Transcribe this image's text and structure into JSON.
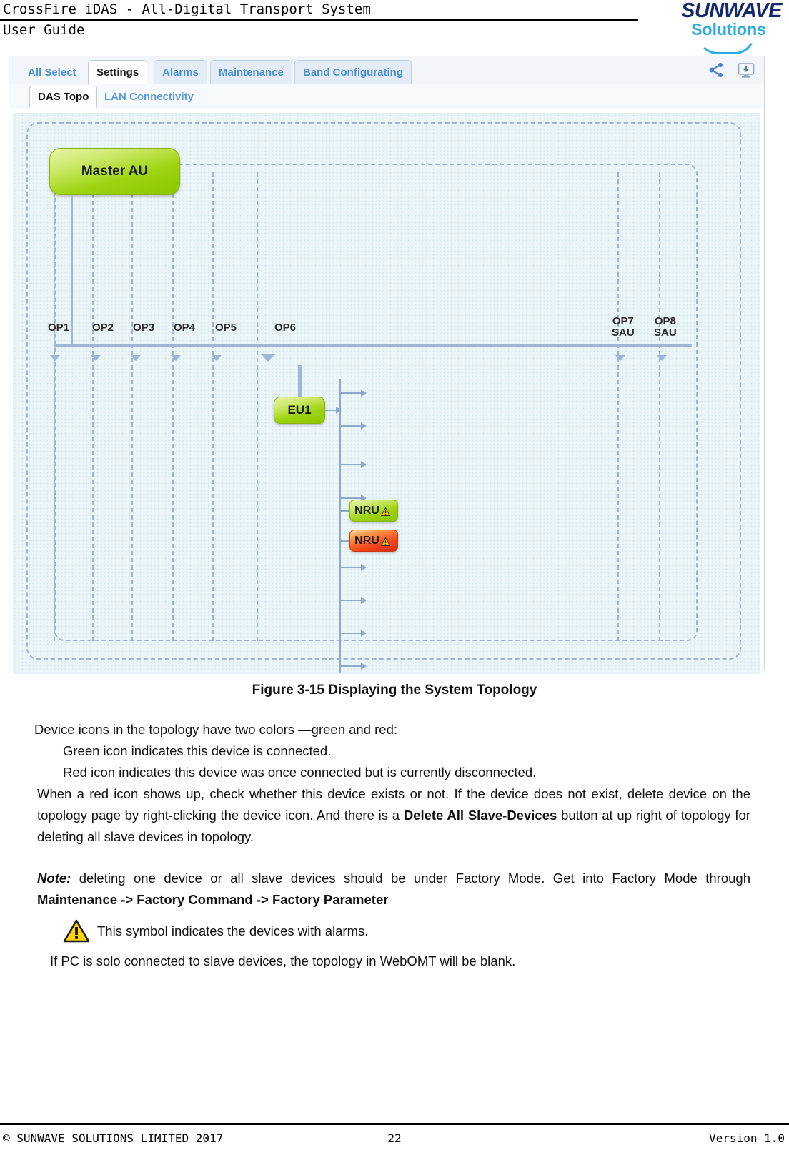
{
  "header": {
    "doc_title": "CrossFire iDAS - All-Digital Transport System",
    "doc_subtitle": "User Guide",
    "logo_primary": "SUNWAVE",
    "logo_secondary": "Solutions"
  },
  "app": {
    "tabs": [
      {
        "label": "All Select",
        "state": "plain"
      },
      {
        "label": "Settings",
        "state": "active"
      },
      {
        "label": "Alarms",
        "state": "idle"
      },
      {
        "label": "Maintenance",
        "state": "idle"
      },
      {
        "label": "Band Configurating",
        "state": "idle"
      }
    ],
    "toolbar_icons": [
      {
        "name": "share-icon"
      },
      {
        "name": "download-screen-icon"
      }
    ],
    "subtabs": [
      {
        "label": "DAS Topo",
        "state": "active"
      },
      {
        "label": "LAN Connectivity",
        "state": "idle"
      }
    ],
    "topology": {
      "master_node": "Master AU",
      "eu_node": "EU1",
      "nru_nodes": [
        {
          "label": "NRU",
          "status": "green"
        },
        {
          "label": "NRU",
          "status": "red"
        }
      ],
      "ports": [
        {
          "label": "OP1",
          "sub": ""
        },
        {
          "label": "OP2",
          "sub": ""
        },
        {
          "label": "OP3",
          "sub": ""
        },
        {
          "label": "OP4",
          "sub": ""
        },
        {
          "label": "OP5",
          "sub": ""
        },
        {
          "label": "OP6",
          "sub": ""
        },
        {
          "label": "OP7",
          "sub": "SAU"
        },
        {
          "label": "OP8",
          "sub": "SAU"
        }
      ],
      "colors": {
        "connected_green": "#9ed310",
        "disconnected_red": "#f3461b",
        "canvas": "#eaf5f8",
        "link": "#9fb6d6"
      }
    }
  },
  "figure": {
    "caption": "Figure 3-15 Displaying the System Topology"
  },
  "body": {
    "line1": "Device icons in the topology have two colors —green and red:",
    "line2": "Green icon indicates this device is connected.",
    "line3": "Red icon indicates this device was once connected but is currently disconnected.",
    "para1_a": "When a red icon shows up, check whether this device exists or not. If the device does not exist, delete device on the topology page by right-clicking the device icon. And there is a ",
    "para1_bold": "Delete All Slave-Devices",
    "para1_b": " button at up right of topology for deleting all slave devices in topology.",
    "note_label": "Note:",
    "note_text": " deleting one device or all slave devices should be under Factory Mode. Get into Factory Mode through ",
    "note_bold": "Maintenance -> Factory Command -> Factory Parameter",
    "alarm_symbol_text": "This symbol indicates the devices with alarms.",
    "last_line": "If PC is solo connected to slave devices, the topology in WebOMT will be blank."
  },
  "footer": {
    "left": "© SUNWAVE SOLUTIONS LIMITED 2017",
    "page": "22",
    "right": "Version 1.0"
  }
}
